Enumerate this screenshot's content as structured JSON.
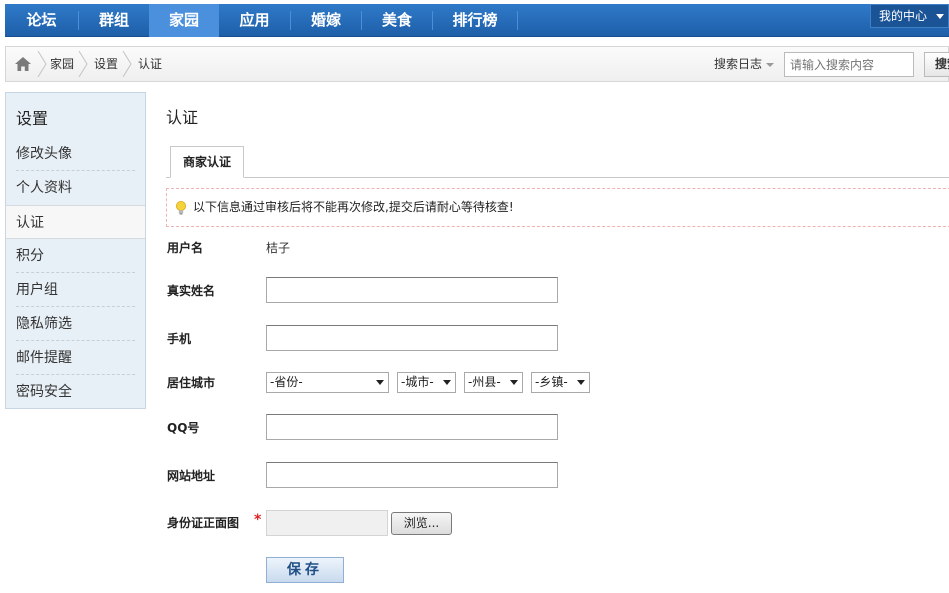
{
  "nav": {
    "items": [
      {
        "label": "论坛"
      },
      {
        "label": "群组"
      },
      {
        "label": "家园"
      },
      {
        "label": "应用"
      },
      {
        "label": "婚嫁"
      },
      {
        "label": "美食"
      },
      {
        "label": "排行榜"
      }
    ],
    "active_index": 2,
    "my_center": "我的中心"
  },
  "breadcrumb": {
    "items": [
      "家园",
      "设置",
      "认证"
    ]
  },
  "search": {
    "scope_label": "搜索日志",
    "placeholder": "请输入搜索内容",
    "button_label": "搜索"
  },
  "sidebar": {
    "title": "设置",
    "items": [
      {
        "label": "修改头像"
      },
      {
        "label": "个人资料"
      },
      {
        "label": "认证"
      },
      {
        "label": "积分"
      },
      {
        "label": "用户组"
      },
      {
        "label": "隐私筛选"
      },
      {
        "label": "邮件提醒"
      },
      {
        "label": "密码安全"
      }
    ],
    "active_index": 2
  },
  "main": {
    "title": "认证",
    "tab_label": "商家认证",
    "notice": "以下信息通过审核后将不能再次修改,提交后请耐心等待核查!",
    "form": {
      "username_label": "用户名",
      "username_value": "桔子",
      "realname_label": "真实姓名",
      "phone_label": "手机",
      "city_label": "居住城市",
      "province": "-省份-",
      "city": "-城市-",
      "county": "-州县-",
      "town": "-乡镇-",
      "qq_label": "QQ号",
      "website_label": "网站地址",
      "idcard_label": "身份证正面图",
      "required_mark": "*",
      "browse_label": "浏览...",
      "save_label": "保存"
    }
  },
  "colors": {
    "nav_bg": "#2f7ac9",
    "nav_active": "#4a90dd",
    "sidebar_bg": "#e8f0f7",
    "required": "#e02020"
  }
}
